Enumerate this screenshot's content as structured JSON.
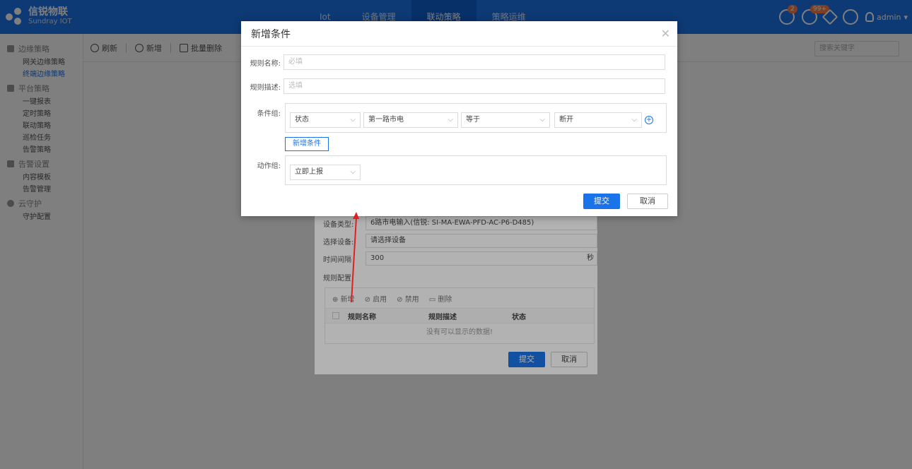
{
  "brand": {
    "name_cn": "信锐物联",
    "name_en": "Sundray IOT"
  },
  "topnav": [
    {
      "label": "Iot"
    },
    {
      "label": "设备管理"
    },
    {
      "label": "联动策略",
      "active": true
    },
    {
      "label": "策略运维"
    }
  ],
  "topright": {
    "bell_badge": "2",
    "msg_badge": "99+",
    "user": "admin"
  },
  "sidebar": {
    "groups": [
      {
        "label": "边缘策略",
        "items": [
          {
            "label": "网关边缘策略"
          },
          {
            "label": "终端边缘策略",
            "active": true
          }
        ]
      },
      {
        "label": "平台策略",
        "items": [
          {
            "label": "一键报表"
          },
          {
            "label": "定时策略"
          },
          {
            "label": "联动策略"
          },
          {
            "label": "巡检任务"
          },
          {
            "label": "告警策略"
          }
        ]
      },
      {
        "label": "告警设置",
        "items": [
          {
            "label": "内容模板"
          },
          {
            "label": "告警管理"
          }
        ]
      },
      {
        "label": "云守护",
        "items": [
          {
            "label": "守护配置"
          }
        ]
      }
    ]
  },
  "toolbar": {
    "refresh": "刷新",
    "add": "新增",
    "delete": "批量删除",
    "search_placeholder": "搜索关键字"
  },
  "under_dialog": {
    "device_type_label": "设备类型:",
    "device_type_value": "6路市电输入(信锐: SI-MA-EWA-PFD-AC-P6-D485)",
    "device_label": "选择设备:",
    "device_value": "请选择设备",
    "interval_label": "时间间隔",
    "interval_value": "300",
    "interval_unit": "秒",
    "rule_config_label": "规则配置",
    "tools": [
      "新增",
      "启用",
      "禁用",
      "删除"
    ],
    "columns": [
      "规则名称",
      "规则描述",
      "状态"
    ],
    "empty": "没有可以显示的数据!",
    "submit": "提交",
    "cancel": "取消"
  },
  "modal": {
    "title": "新增条件",
    "rule_name_label": "规则名称:",
    "rule_name_placeholder": "必填",
    "rule_desc_label": "规则描述:",
    "rule_desc_placeholder": "选填",
    "cond_group_label": "条件组:",
    "cond_selects": [
      "状态",
      "第一路市电",
      "等于",
      "断开"
    ],
    "add_condition": "新增条件",
    "action_group_label": "动作组:",
    "action_select": "立即上报",
    "submit": "提交",
    "cancel": "取消"
  },
  "colors": {
    "primary": "#1a73e8",
    "overlay": "rgba(0,0,0,0.5)",
    "arrow": "#e02020"
  }
}
